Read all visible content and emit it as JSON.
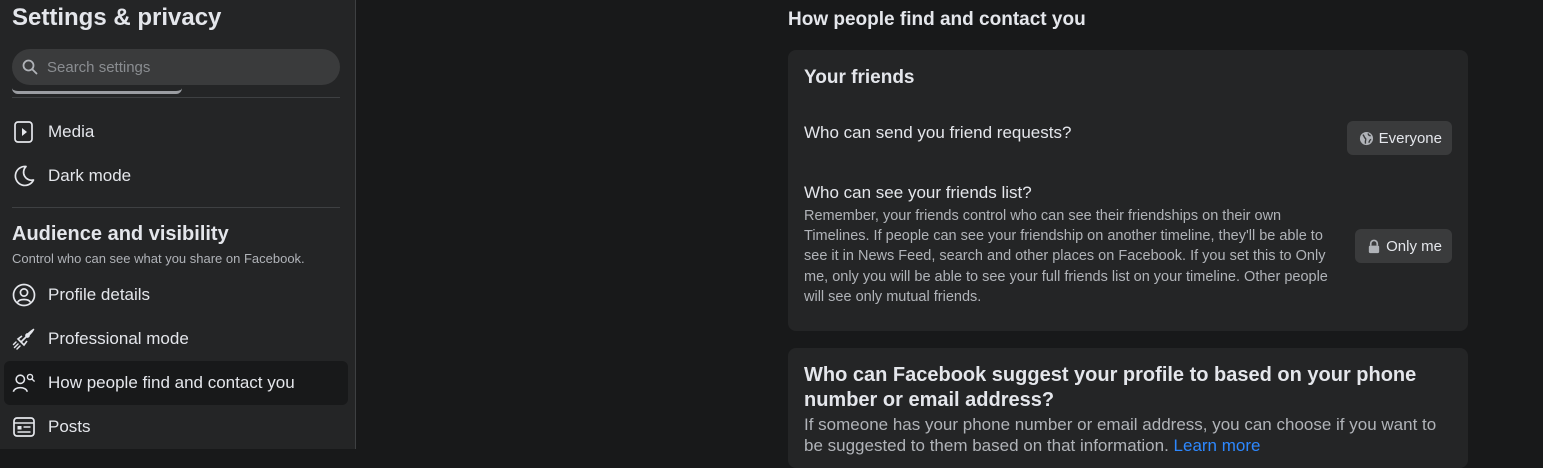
{
  "sidebar": {
    "title": "Settings & privacy",
    "search_placeholder": "Search settings",
    "items_top": [
      {
        "label": "Media",
        "icon": "media-icon"
      },
      {
        "label": "Dark mode",
        "icon": "moon-icon"
      }
    ],
    "section": {
      "title": "Audience and visibility",
      "subtitle": "Control who can see what you share on Facebook."
    },
    "items": [
      {
        "label": "Profile details",
        "icon": "user-circle-icon"
      },
      {
        "label": "Professional mode",
        "icon": "rocket-icon"
      },
      {
        "label": "How people find and contact you",
        "icon": "people-search-icon",
        "active": true
      },
      {
        "label": "Posts",
        "icon": "posts-icon"
      }
    ]
  },
  "main": {
    "heading": "How people find and contact you",
    "friends_card": {
      "title": "Your friends",
      "friend_requests": {
        "question": "Who can send you friend requests?",
        "audience": "Everyone",
        "audience_icon": "globe-icon"
      },
      "friends_list": {
        "question": "Who can see your friends list?",
        "description": "Remember, your friends control who can see their friendships on their own Timelines. If people can see your friendship on another timeline, they'll be able to see it in News Feed, search and other places on Facebook. If you set this to Only me, only you will be able to see your full friends list on your timeline. Other people will see only mutual friends.",
        "audience": "Only me",
        "audience_icon": "lock-icon"
      }
    },
    "suggest_card": {
      "title": "Who can Facebook suggest your profile to based on your phone number or email address?",
      "description": "If someone has your phone number or email address, you can choose if you want to be suggested to them based on that information.",
      "link": "Learn more"
    }
  },
  "colors": {
    "background": "#18191a",
    "surface": "#242526",
    "button": "#3a3b3c",
    "text_primary": "#e4e6eb",
    "text_secondary": "#b0b3b8",
    "link": "#2d88ff"
  }
}
